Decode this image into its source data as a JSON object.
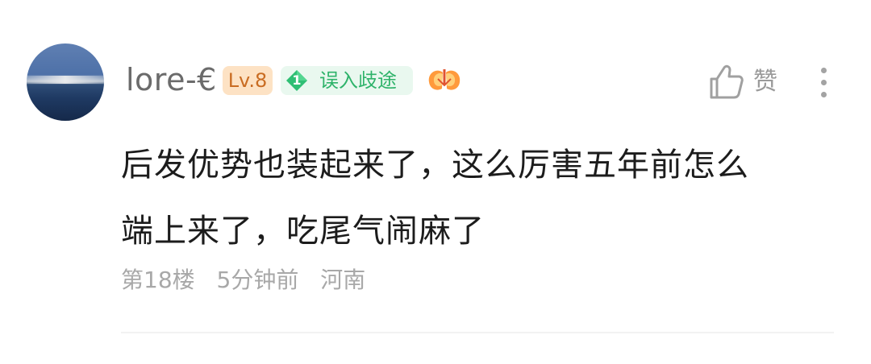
{
  "comment": {
    "username": "lore-€",
    "level_badge": "Lv.8",
    "title_badge": {
      "number": "1",
      "text": "误入歧途"
    },
    "like_label": "赞",
    "text": "后发优势也装起来了，这么厉害五年前怎么\n端上来了，吃尾气闹麻了",
    "floor": "第18楼",
    "time": "5分钟前",
    "location": "河南"
  },
  "colors": {
    "level_badge_bg": "#fde2c4",
    "level_badge_text": "#c96c22",
    "title_badge_bg": "#e9f8ef",
    "title_badge_text": "#2eb36a",
    "meta_text": "#a8a8a8"
  },
  "icons": {
    "avatar": "avatar",
    "title_badge_icon": "diamond-badge-icon",
    "decoration": "lungs-heart-icon",
    "like": "thumbs-up-icon",
    "more": "more-vertical-icon"
  }
}
